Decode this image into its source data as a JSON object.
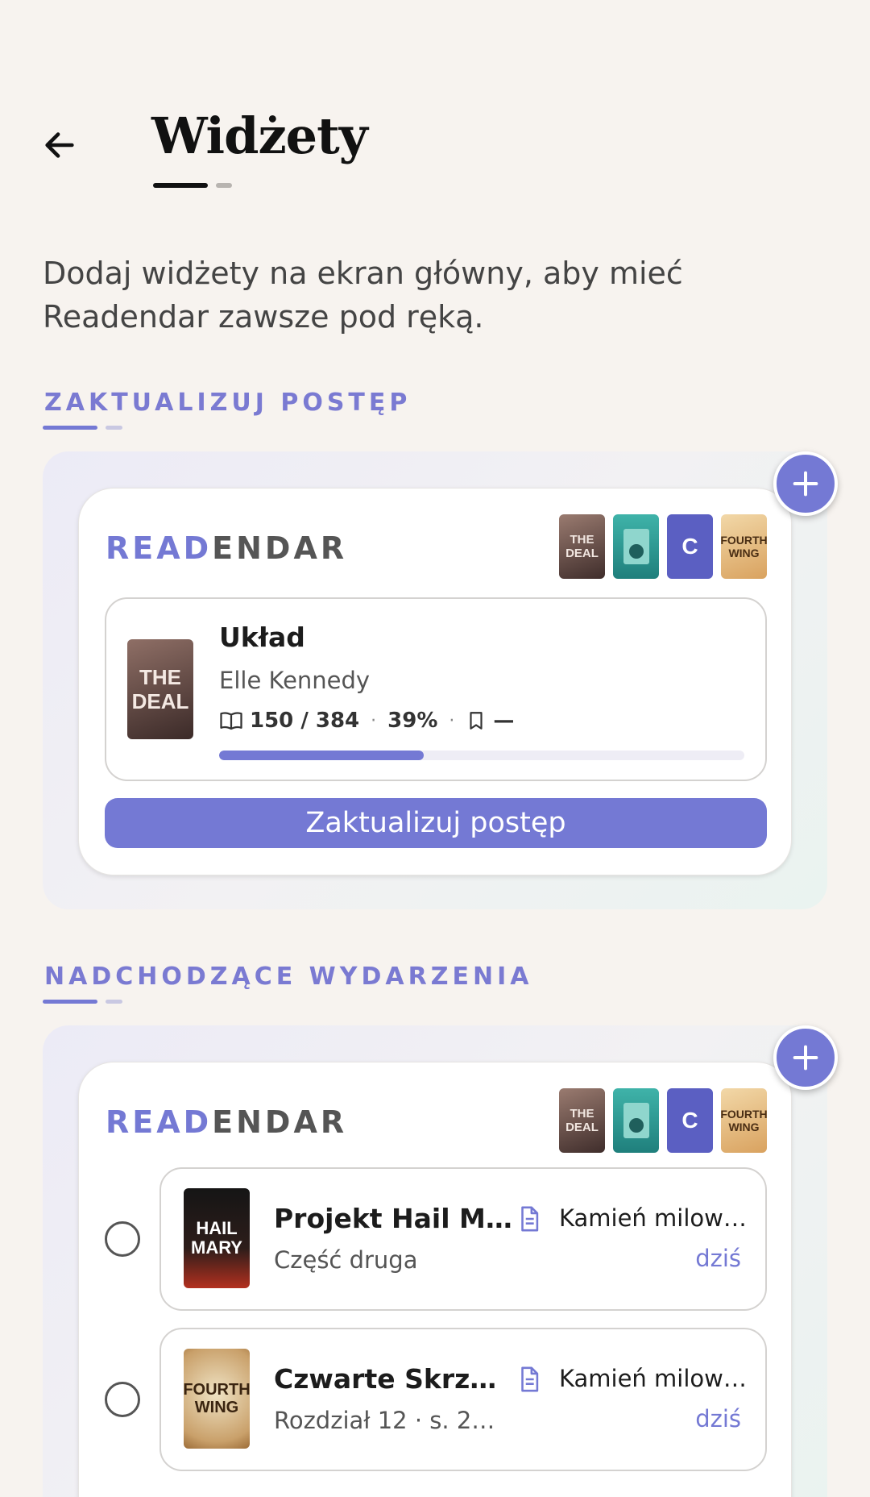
{
  "header": {
    "title": "Widżety"
  },
  "intro": "Dodaj widżety na ekran główny, aby mieć Readendar zawsze pod ręką.",
  "brand": {
    "accent": "READ",
    "rest": "ENDAR"
  },
  "thumbs": {
    "deal": "THE DEAL",
    "c": "C",
    "wing": "FOURTH WING"
  },
  "progress_section": {
    "label": "ZAKTUALIZUJ POSTĘP",
    "book": {
      "cover_text": "THE DEAL",
      "title": "Układ",
      "author": "Elle Kennedy",
      "pages": "150 / 384",
      "percent": "39%",
      "bookmark": "—",
      "progress": 0.39
    },
    "button_label": "Zaktualizuj postęp"
  },
  "upcoming_section": {
    "label": "NADCHODZĄCE WYDARZENIA",
    "events": [
      {
        "cover_text": "HAIL MARY",
        "title": "Projekt Hail M…",
        "subtitle": "Część druga",
        "type": "Kamień milow…",
        "date": "dziś"
      },
      {
        "cover_text": "FOURTH WING",
        "title": "Czwarte Skrz…",
        "subtitle": "Rozdział 12 · s. 2…",
        "type": "Kamień milow…",
        "date": "dziś"
      }
    ]
  },
  "colors": {
    "accent": "#7479d4",
    "background": "#f7f3ef",
    "thumb_c": "#5b5fc2"
  },
  "icons": [
    "arrow-left-icon",
    "plus-icon",
    "book-open-icon",
    "bookmark-icon",
    "document-icon"
  ]
}
